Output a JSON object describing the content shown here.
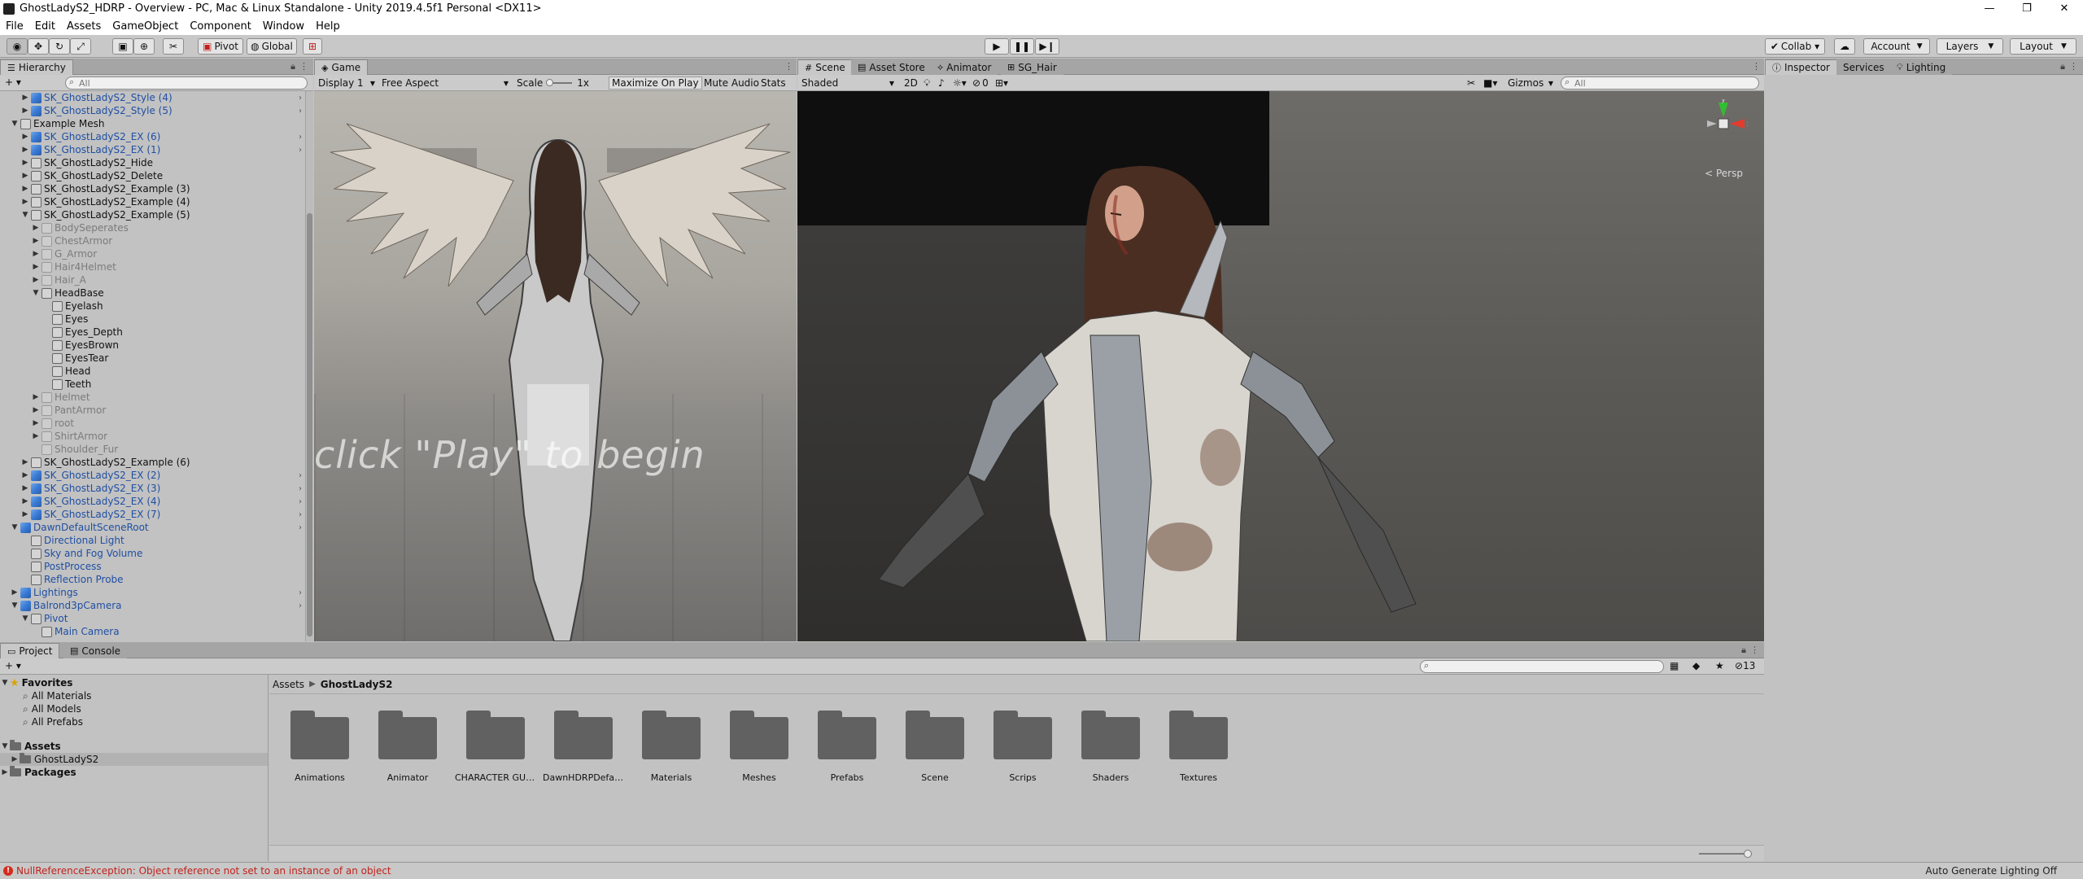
{
  "window": {
    "title": "GhostLadyS2_HDRP - Overview - PC, Mac & Linux Standalone - Unity 2019.4.5f1 Personal <DX11>",
    "minimize": "—",
    "restore": "❐",
    "close": "✕"
  },
  "menu": [
    "File",
    "Edit",
    "Assets",
    "GameObject",
    "Component",
    "Window",
    "Help"
  ],
  "toolbar": {
    "pivot": "Pivot",
    "global": "Global",
    "collab": "Collab ▾",
    "account": "Account",
    "layers": "Layers",
    "layout": "Layout"
  },
  "hierarchy": {
    "tab": "Hierarchy",
    "add": "+ ▾",
    "search_placeholder": "All",
    "rows": [
      {
        "indent": 3,
        "arrow": "▶",
        "icon": "blue",
        "label": "SK_GhostLadyS2_Style (4)",
        "style": "prefab",
        "chev": true
      },
      {
        "indent": 3,
        "arrow": "▶",
        "icon": "blue",
        "label": "SK_GhostLadyS2_Style (5)",
        "style": "prefab",
        "chev": true
      },
      {
        "indent": 2,
        "arrow": "▼",
        "icon": "grey",
        "label": "Example Mesh",
        "style": "normal",
        "chev": false
      },
      {
        "indent": 3,
        "arrow": "▶",
        "icon": "blue",
        "label": "SK_GhostLadyS2_EX (6)",
        "style": "prefab",
        "chev": true
      },
      {
        "indent": 3,
        "arrow": "▶",
        "icon": "blue",
        "label": "SK_GhostLadyS2_EX (1)",
        "style": "prefab",
        "chev": true
      },
      {
        "indent": 3,
        "arrow": "▶",
        "icon": "grey",
        "label": "SK_GhostLadyS2_Hide",
        "style": "normal",
        "chev": false
      },
      {
        "indent": 3,
        "arrow": "▶",
        "icon": "grey",
        "label": "SK_GhostLadyS2_Delete",
        "style": "normal",
        "chev": false
      },
      {
        "indent": 3,
        "arrow": "▶",
        "icon": "grey",
        "label": "SK_GhostLadyS2_Example (3)",
        "style": "normal",
        "chev": false
      },
      {
        "indent": 3,
        "arrow": "▶",
        "icon": "grey",
        "label": "SK_GhostLadyS2_Example (4)",
        "style": "normal",
        "chev": false
      },
      {
        "indent": 3,
        "arrow": "▼",
        "icon": "grey",
        "label": "SK_GhostLadyS2_Example (5)",
        "style": "normal",
        "chev": false
      },
      {
        "indent": 4,
        "arrow": "▶",
        "icon": "fade",
        "label": "BodySeperates",
        "style": "inactive",
        "chev": false
      },
      {
        "indent": 4,
        "arrow": "▶",
        "icon": "fade",
        "label": "ChestArmor",
        "style": "inactive",
        "chev": false
      },
      {
        "indent": 4,
        "arrow": "▶",
        "icon": "fade",
        "label": "G_Armor",
        "style": "inactive",
        "chev": false
      },
      {
        "indent": 4,
        "arrow": "▶",
        "icon": "fade",
        "label": "Hair4Helmet",
        "style": "inactive",
        "chev": false
      },
      {
        "indent": 4,
        "arrow": "▶",
        "icon": "fade",
        "label": "Hair_A",
        "style": "inactive",
        "chev": false
      },
      {
        "indent": 4,
        "arrow": "▼",
        "icon": "grey",
        "label": "HeadBase",
        "style": "normal",
        "chev": false
      },
      {
        "indent": 5,
        "arrow": "",
        "icon": "grey",
        "label": "Eyelash",
        "style": "normal",
        "chev": false
      },
      {
        "indent": 5,
        "arrow": "",
        "icon": "grey",
        "label": "Eyes",
        "style": "normal",
        "chev": false
      },
      {
        "indent": 5,
        "arrow": "",
        "icon": "grey",
        "label": "Eyes_Depth",
        "style": "normal",
        "chev": false
      },
      {
        "indent": 5,
        "arrow": "",
        "icon": "grey",
        "label": "EyesBrown",
        "style": "normal",
        "chev": false
      },
      {
        "indent": 5,
        "arrow": "",
        "icon": "grey",
        "label": "EyesTear",
        "style": "normal",
        "chev": false
      },
      {
        "indent": 5,
        "arrow": "",
        "icon": "grey",
        "label": "Head",
        "style": "normal",
        "chev": false
      },
      {
        "indent": 5,
        "arrow": "",
        "icon": "grey",
        "label": "Teeth",
        "style": "normal",
        "chev": false
      },
      {
        "indent": 4,
        "arrow": "▶",
        "icon": "fade",
        "label": "Helmet",
        "style": "inactive",
        "chev": false
      },
      {
        "indent": 4,
        "arrow": "▶",
        "icon": "fade",
        "label": "PantArmor",
        "style": "inactive",
        "chev": false
      },
      {
        "indent": 4,
        "arrow": "▶",
        "icon": "fade",
        "label": "root",
        "style": "inactive",
        "chev": false
      },
      {
        "indent": 4,
        "arrow": "▶",
        "icon": "fade",
        "label": "ShirtArmor",
        "style": "inactive",
        "chev": false
      },
      {
        "indent": 4,
        "arrow": "",
        "icon": "fade",
        "label": "Shoulder_Fur",
        "style": "inactive",
        "chev": false
      },
      {
        "indent": 3,
        "arrow": "▶",
        "icon": "grey",
        "label": "SK_GhostLadyS2_Example (6)",
        "style": "normal",
        "chev": false
      },
      {
        "indent": 3,
        "arrow": "▶",
        "icon": "blue",
        "label": "SK_GhostLadyS2_EX (2)",
        "style": "prefab",
        "chev": true
      },
      {
        "indent": 3,
        "arrow": "▶",
        "icon": "blue",
        "label": "SK_GhostLadyS2_EX (3)",
        "style": "prefab",
        "chev": true
      },
      {
        "indent": 3,
        "arrow": "▶",
        "icon": "blue",
        "label": "SK_GhostLadyS2_EX (4)",
        "style": "prefab",
        "chev": true
      },
      {
        "indent": 3,
        "arrow": "▶",
        "icon": "blue",
        "label": "SK_GhostLadyS2_EX (7)",
        "style": "prefab",
        "chev": true
      },
      {
        "indent": 2,
        "arrow": "▼",
        "icon": "blue",
        "label": "DawnDefaultSceneRoot",
        "style": "prefab",
        "chev": true
      },
      {
        "indent": 3,
        "arrow": "",
        "icon": "grey",
        "label": "Directional Light",
        "style": "prefab",
        "chev": false
      },
      {
        "indent": 3,
        "arrow": "",
        "icon": "grey",
        "label": "Sky and Fog Volume",
        "style": "prefab",
        "chev": false
      },
      {
        "indent": 3,
        "arrow": "",
        "icon": "grey",
        "label": "PostProcess",
        "style": "prefab",
        "chev": false
      },
      {
        "indent": 3,
        "arrow": "",
        "icon": "grey",
        "label": "Reflection Probe",
        "style": "prefab",
        "chev": false
      },
      {
        "indent": 2,
        "arrow": "▶",
        "icon": "blue",
        "label": "Lightings",
        "style": "prefab",
        "chev": true
      },
      {
        "indent": 2,
        "arrow": "▼",
        "icon": "blue",
        "label": "Balrond3pCamera",
        "style": "prefab",
        "chev": true
      },
      {
        "indent": 3,
        "arrow": "▼",
        "icon": "grey",
        "label": "Pivot",
        "style": "prefab",
        "chev": false
      },
      {
        "indent": 4,
        "arrow": "",
        "icon": "grey",
        "label": "Main Camera",
        "style": "prefab",
        "chev": false
      }
    ]
  },
  "game": {
    "tab": "Game",
    "display": "Display 1",
    "aspect": "Free Aspect",
    "scale_label": "Scale",
    "scale_value": "1x",
    "maximize": "Maximize On Play",
    "mute": "Mute Audio",
    "stats": "Stats",
    "overlay_text": "click \"Play\" to begin"
  },
  "scene": {
    "tabs": [
      "Scene",
      "Asset Store",
      "Animator",
      "SG_Hair"
    ],
    "shading": "Shaded",
    "mode2d": "2D",
    "fx_count": "0",
    "gizmos": "Gizmos",
    "search_placeholder": "All",
    "persp": "< Persp"
  },
  "inspector": {
    "tabs": [
      "Inspector",
      "Services",
      "Lighting"
    ]
  },
  "project": {
    "tabs": [
      "Project",
      "Console"
    ],
    "add": "+ ▾",
    "hidden_count": "13",
    "favorites_label": "Favorites",
    "favorites": [
      "All Materials",
      "All Models",
      "All Prefabs"
    ],
    "assets_label": "Assets",
    "assets_child": "GhostLadyS2",
    "packages_label": "Packages",
    "breadcrumb_root": "Assets",
    "breadcrumb_current": "GhostLadyS2",
    "folders": [
      "Animations",
      "Animator",
      "CHARACTER GUI...",
      "DawnHDRPDefaul...",
      "Materials",
      "Meshes",
      "Prefabs",
      "Scene",
      "Scrips",
      "Shaders",
      "Textures"
    ]
  },
  "status": {
    "error": "NullReferenceException: Object reference not set to an instance of an object",
    "right": "Auto Generate Lighting Off"
  }
}
